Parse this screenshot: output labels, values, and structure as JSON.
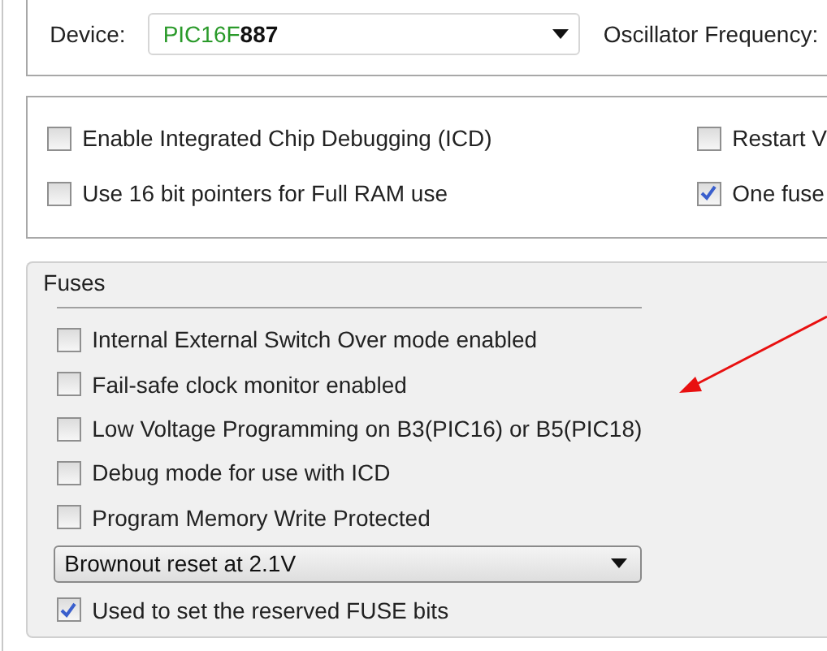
{
  "device": {
    "label": "Device:",
    "family": "PIC16F",
    "model": "887",
    "oscillator_label": "Oscillator Frequency:"
  },
  "options": {
    "left": [
      {
        "label": "Enable Integrated Chip Debugging (ICD)",
        "checked": false
      },
      {
        "label": "Use 16 bit pointers for Full RAM use",
        "checked": false
      }
    ],
    "right": [
      {
        "label": "Restart V",
        "checked": false
      },
      {
        "label": "One fuse",
        "checked": true
      }
    ]
  },
  "fuses": {
    "title": "Fuses",
    "items": [
      {
        "kind": "checkbox",
        "label": "Internal External Switch Over mode enabled",
        "checked": false
      },
      {
        "kind": "checkbox",
        "label": "Fail-safe clock monitor enabled",
        "checked": false
      },
      {
        "kind": "checkbox",
        "label": "Low Voltage Programming on B3(PIC16) or B5(PIC18)",
        "checked": false
      },
      {
        "kind": "checkbox",
        "label": "Debug mode for use with ICD",
        "checked": false
      },
      {
        "kind": "checkbox",
        "label": "Program Memory Write Protected",
        "checked": false
      },
      {
        "kind": "dropdown",
        "value": "Brownout reset at 2.1V"
      },
      {
        "kind": "checkbox",
        "label": "Used to set the reserved FUSE bits",
        "checked": true
      }
    ]
  }
}
